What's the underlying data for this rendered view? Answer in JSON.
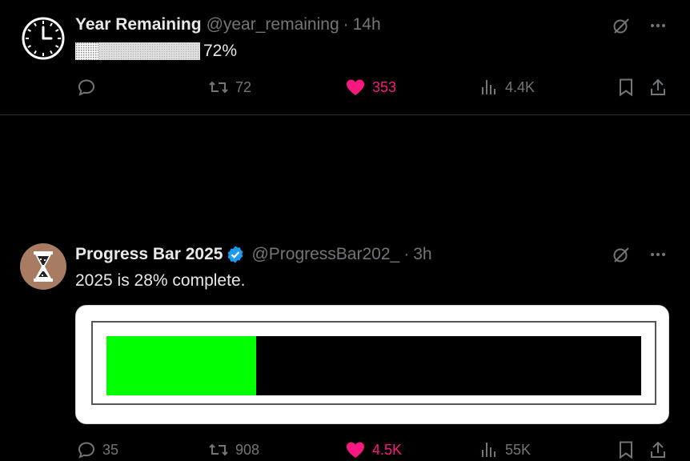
{
  "tweets": [
    {
      "name": "Year Remaining",
      "handle": "@year_remaining",
      "sep": "·",
      "time": "14h",
      "text": "72%",
      "remaining_fraction": 0.72,
      "stats": {
        "replies": "",
        "retweets": "72",
        "likes": "353",
        "views": "4.4K"
      },
      "avatar_icon": "clock-icon"
    },
    {
      "name": "Progress Bar 2025",
      "handle": "@ProgressBar202_",
      "sep": "·",
      "time": "3h",
      "text": "2025 is 28% complete.",
      "progress_fraction": 0.28,
      "stats": {
        "replies": "35",
        "retweets": "908",
        "likes": "4.5K",
        "views": "55K"
      },
      "avatar_icon": "hourglass-icon",
      "colors": {
        "fill": "#00ff00",
        "track": "#000000",
        "verified": "#1d9bf0"
      }
    }
  ],
  "colors": {
    "like": "#f91880",
    "muted": "#71767b",
    "text": "#e7e9ea"
  }
}
